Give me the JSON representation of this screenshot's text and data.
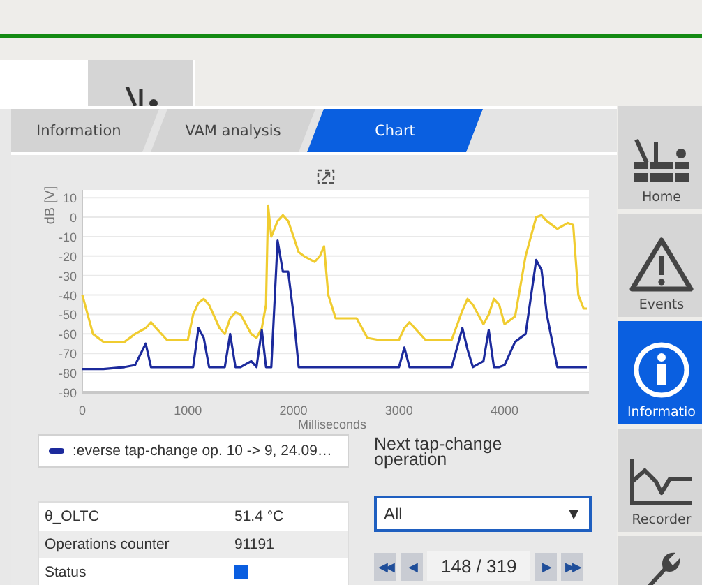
{
  "tabs": [
    {
      "label": "Information",
      "selected": false
    },
    {
      "label": "VAM analysis",
      "selected": false
    },
    {
      "label": "Chart",
      "selected": true
    }
  ],
  "chart": {
    "chart_data": {
      "type": "line",
      "ylabel": "dB [V]",
      "xlabel": "Milliseconds",
      "x": [
        0,
        100,
        200,
        400,
        500,
        600,
        650,
        700,
        800,
        1000,
        1050,
        1100,
        1150,
        1200,
        1300,
        1350,
        1400,
        1450,
        1500,
        1600,
        1650,
        1700,
        1740,
        1760,
        1790,
        1850,
        1900,
        1950,
        2000,
        2050,
        2100,
        2200,
        2250,
        2290,
        2330,
        2400,
        2600,
        2700,
        2800,
        3000,
        3050,
        3100,
        3150,
        3250,
        3500,
        3600,
        3650,
        3700,
        3800,
        3850,
        3900,
        3950,
        4000,
        4100,
        4200,
        4300,
        4350,
        4400,
        4500,
        4600,
        4650,
        4700,
        4750,
        4780
      ],
      "series": [
        {
          "color": "#f0cc30",
          "values": [
            -40,
            -60,
            -64,
            -64,
            -60,
            -57,
            -54,
            -57,
            -63,
            -63,
            -50,
            -44,
            -42,
            -45,
            -57,
            -60,
            -52,
            -49,
            -50,
            -60,
            -62,
            -57,
            -45,
            6,
            -10,
            -2,
            1,
            -2,
            -10,
            -18,
            -20,
            -23,
            -20,
            -15,
            -40,
            -52,
            -52,
            -62,
            -63,
            -63,
            -57,
            -54,
            -57,
            -63,
            -63,
            -48,
            -42,
            -45,
            -55,
            -50,
            -42,
            -45,
            -55,
            -51,
            -20,
            0,
            1,
            -2,
            -6,
            -3,
            -4,
            -40,
            -47,
            -47
          ]
        },
        {
          "name": ":everse tap-change op. 10 -> 9, 24.09…",
          "color": "#1c2a9c",
          "values": [
            -78,
            -78,
            -78,
            -77,
            -76,
            -65,
            -77,
            -77,
            -77,
            -77,
            -77,
            -57,
            -62,
            -77,
            -77,
            -77,
            -60,
            -77,
            -77,
            -74,
            -77,
            -58,
            -77,
            -77,
            -77,
            -12,
            -28,
            -28,
            -50,
            -77,
            -77,
            -77,
            -77,
            -77,
            -77,
            -77,
            -77,
            -77,
            -77,
            -77,
            -67,
            -77,
            -77,
            -77,
            -77,
            -57,
            -68,
            -77,
            -74,
            -58,
            -77,
            -77,
            -76,
            -64,
            -60,
            -22,
            -27,
            -50,
            -77,
            -77,
            -77,
            -77,
            -77,
            -77
          ]
        }
      ],
      "grid": true,
      "xlim": [
        0,
        4800
      ],
      "ylim": [
        -90,
        14
      ],
      "xticks": [
        0,
        1000,
        2000,
        3000,
        4000
      ],
      "yticks": [
        -90,
        -80,
        -70,
        -60,
        -50,
        -40,
        -30,
        -20,
        -10,
        0,
        10
      ]
    }
  },
  "info_table": [
    {
      "label": "θ_OLTC",
      "kind": "text",
      "value": "51.4 °C"
    },
    {
      "label": "Operations counter",
      "kind": "text",
      "value": "91191"
    },
    {
      "label": "Status",
      "kind": "indicator",
      "color": "#0a5ee0"
    }
  ],
  "next_operation": {
    "title": "Next tap-change operation",
    "filter": {
      "value": "All",
      "arrow": "▼"
    },
    "pager": {
      "first": "◀◀",
      "prev": "◀",
      "position": "148 / 319",
      "next": "▶",
      "last": "▶▶"
    }
  },
  "sidebar": [
    {
      "label": "Home",
      "selected": false
    },
    {
      "label": "Events",
      "selected": false
    },
    {
      "label": "Informatio",
      "selected": true
    },
    {
      "label": "Recorder",
      "selected": false
    },
    {
      "selected": false
    }
  ]
}
